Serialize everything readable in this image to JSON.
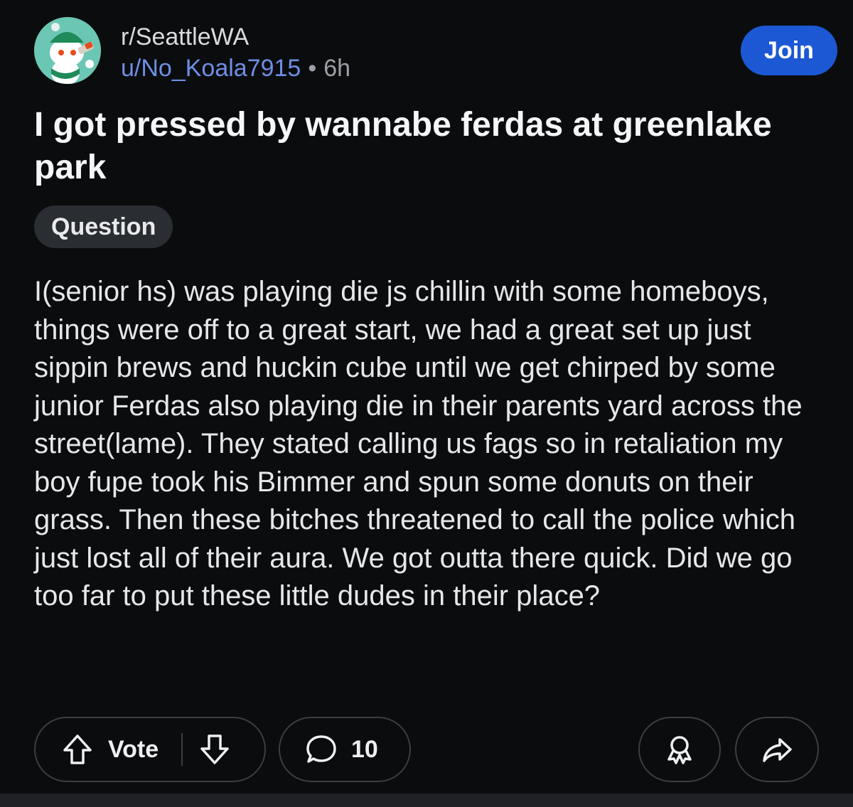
{
  "post": {
    "subreddit": "r/SeattleWA",
    "username": "u/No_Koala7915",
    "separator": "•",
    "age": "6h",
    "join_label": "Join",
    "title": "I got pressed by wannabe ferdas at greenlake park",
    "flair": "Question",
    "body": "I(senior hs) was playing die js chillin with some homeboys, things were off to a great start, we had a great set up just sippin brews and huckin cube until we get chirped by some junior Ferdas also playing die in their parents yard across the street(lame). They stated calling us fags so in retaliation my boy fupe took his Bimmer and spun some donuts on their grass. Then these bitches threatened to call the police which just lost all of their aura. We got outta there quick. Did we go too far to put these little dudes in their place?"
  },
  "actions": {
    "vote_label": "Vote",
    "comment_count": "10"
  },
  "icons": {
    "upvote": "upvote-arrow-icon",
    "downvote": "downvote-arrow-icon",
    "comment": "comment-bubble-icon",
    "award": "award-icon",
    "share": "share-arrow-icon"
  },
  "colors": {
    "background": "#0b0c0e",
    "join_button": "#1c58d4",
    "username": "#6e8fe6",
    "flair_bg": "#2a2d31"
  }
}
